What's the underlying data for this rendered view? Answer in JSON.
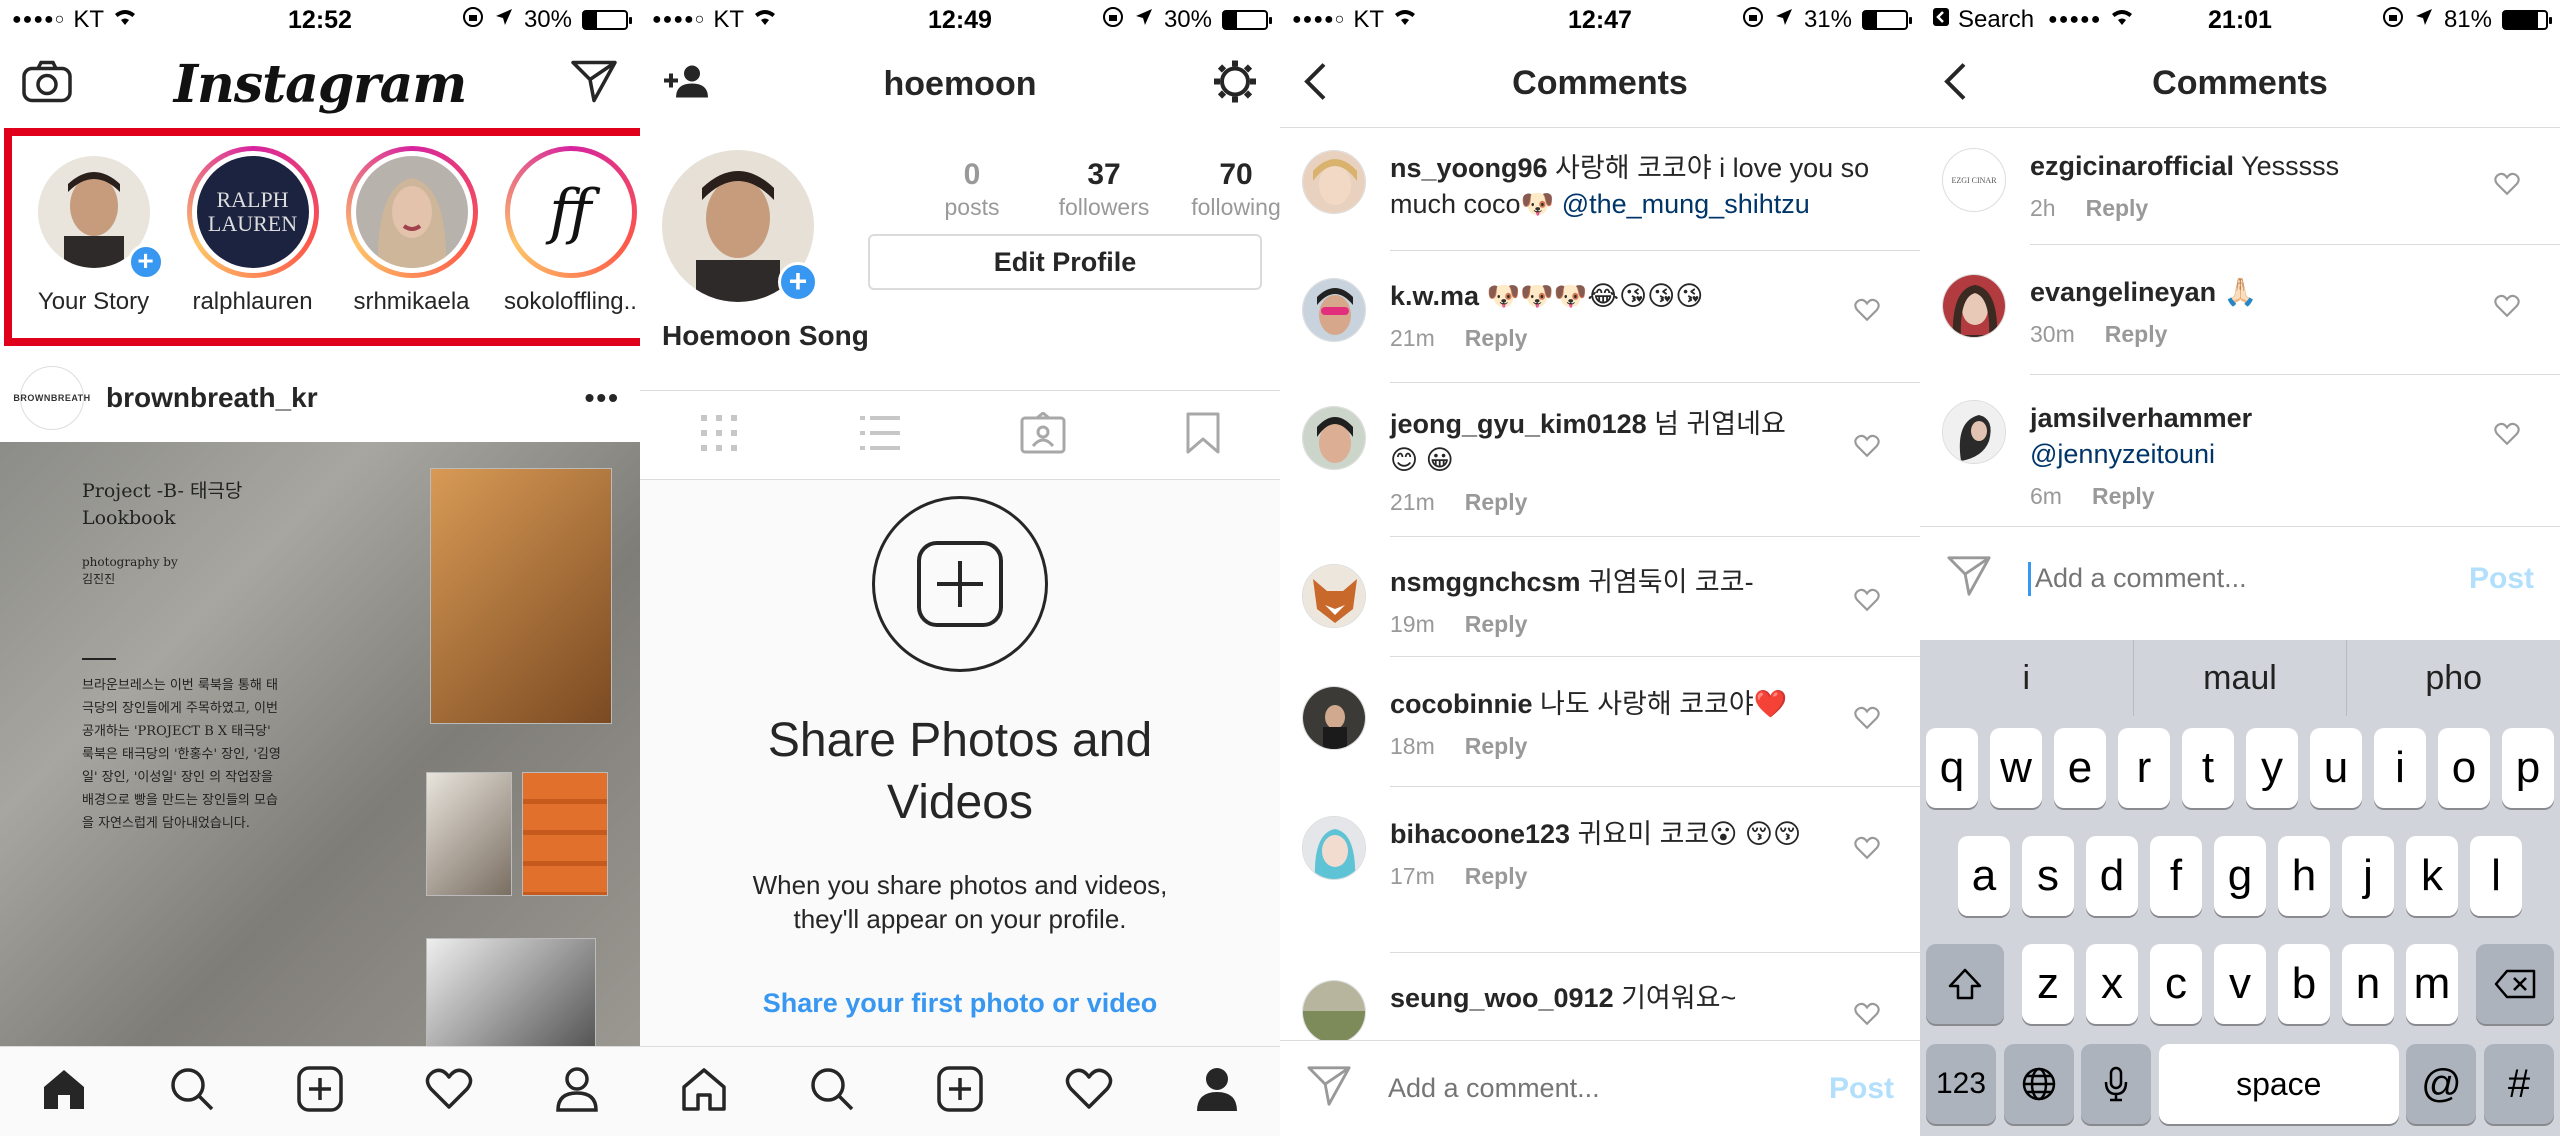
{
  "screen1": {
    "status": {
      "carrier": "KT",
      "time": "12:52",
      "battery": "30%",
      "battery_level": 0.3
    },
    "logo": "Instagram",
    "stories": [
      {
        "label": "Your Story",
        "own": true
      },
      {
        "label": "ralphlauren",
        "avatar_text": "RALPH LAUREN"
      },
      {
        "label": "srhmikaela"
      },
      {
        "label": "sokoloffling..",
        "avatar_text": "ff"
      }
    ],
    "post": {
      "username": "brownbreath_kr",
      "avatar_text": "BROWNBREATH",
      "more": "•••",
      "lookbook_title_1": "Project -B- 태극당",
      "lookbook_title_2": "Lookbook",
      "lookbook_credit_1": "photography by",
      "lookbook_credit_2": "김진진",
      "lookbook_body": "브라운브레스는 이번 룩북을 통해 태극당의 장인들에게 주목하였고, 이번 공개하는 'PROJECT B X 태극당' 룩북은 태극당의 '한홍수' 장인, '김영일' 장인, '이성일' 장인 의 작업장을 배경으로 빵을 만드는 장인들의 모습을 자연스럽게 담아내었습니다."
    }
  },
  "screen2": {
    "status": {
      "carrier": "KT",
      "time": "12:49",
      "battery": "30%",
      "battery_level": 0.3
    },
    "title": "hoemoon",
    "stats": [
      {
        "num": "0",
        "label": "posts"
      },
      {
        "num": "37",
        "label": "followers"
      },
      {
        "num": "70",
        "label": "following"
      }
    ],
    "edit_profile": "Edit Profile",
    "display_name": "Hoemoon Song",
    "share_title_1": "Share Photos and",
    "share_title_2": "Videos",
    "share_sub_1": "When you share photos and videos,",
    "share_sub_2": "they'll appear on your profile.",
    "share_link": "Share your first photo or video"
  },
  "screen3": {
    "status": {
      "carrier": "KT",
      "time": "12:47",
      "battery": "31%",
      "battery_level": 0.31
    },
    "title": "Comments",
    "comments": [
      {
        "user": "ns_yoong96",
        "text": " 사랑해 코코야  i love you so much coco🐶 ",
        "mention": "@the_mung_shihtzu",
        "time": "",
        "reply": ""
      },
      {
        "user": "k.w.ma",
        "text": " 🐶🐶🐶😂😘😘😘",
        "time": "21m",
        "reply": "Reply"
      },
      {
        "user": "jeong_gyu_kim0128",
        "text": " 넘 귀엽네요😊 😀",
        "time": "21m",
        "reply": "Reply"
      },
      {
        "user": "nsmggnchcsm",
        "text": " 귀염둑이 코코-",
        "time": "19m",
        "reply": "Reply"
      },
      {
        "user": "cocobinnie",
        "text": " 나도 사랑해 코코야❤️",
        "time": "18m",
        "reply": "Reply"
      },
      {
        "user": "bihacoone123",
        "text": " 귀요미 코코😮 😚😚",
        "time": "17m",
        "reply": "Reply"
      },
      {
        "user": "seung_woo_0912",
        "text": " 기여워요~",
        "time": "",
        "reply": ""
      }
    ],
    "input_placeholder": "Add a comment...",
    "post_label": "Post"
  },
  "screen4": {
    "status": {
      "back_app": "Search",
      "time": "21:01",
      "battery": "81%",
      "battery_level": 0.81
    },
    "title": "Comments",
    "comments": [
      {
        "user": "ezgicinarofficial",
        "text": " Yesssss",
        "avatar_text": "EZGI CINAR",
        "time": "2h",
        "reply": "Reply"
      },
      {
        "user": "evangelineyan",
        "text": " 🙏🏻",
        "time": "30m",
        "reply": "Reply"
      },
      {
        "user": "jamsilverhammer",
        "text": "",
        "mention": "@jennyzeitouni",
        "time": "6m",
        "reply": "Reply"
      }
    ],
    "input_placeholder": "Add a comment...",
    "post_label": "Post",
    "keyboard": {
      "suggestions": [
        "i",
        "maul",
        "pho"
      ],
      "row1": [
        "q",
        "w",
        "e",
        "r",
        "t",
        "y",
        "u",
        "i",
        "o",
        "p"
      ],
      "row2": [
        "a",
        "s",
        "d",
        "f",
        "g",
        "h",
        "j",
        "k",
        "l"
      ],
      "row3": [
        "z",
        "x",
        "c",
        "v",
        "b",
        "n",
        "m"
      ],
      "numbers": "123",
      "space": "space",
      "at": "@",
      "hash": "#"
    }
  }
}
